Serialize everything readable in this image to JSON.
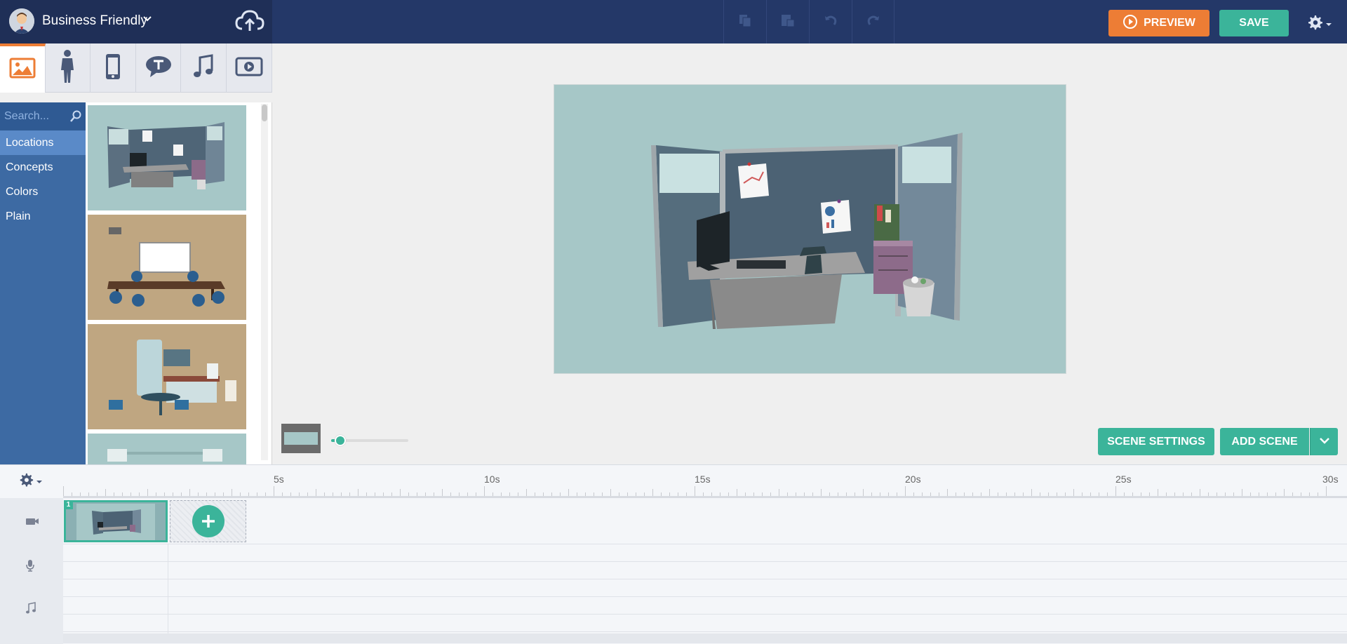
{
  "header": {
    "title": "Business Friendly",
    "preview_label": "PREVIEW",
    "save_label": "SAVE"
  },
  "search": {
    "placeholder": "Search..."
  },
  "categories": [
    {
      "label": "Locations",
      "active": true
    },
    {
      "label": "Concepts",
      "active": false
    },
    {
      "label": "Colors",
      "active": false
    },
    {
      "label": "Plain",
      "active": false
    }
  ],
  "asset_tabs": [
    "backgrounds-icon",
    "characters-icon",
    "device-icon",
    "text-bubble-icon",
    "music-icon",
    "video-icon"
  ],
  "toolbar_icons": [
    "copy-icon",
    "paste-icon",
    "undo-icon",
    "redo-icon"
  ],
  "scene": {
    "settings_label": "SCENE SETTINGS",
    "add_scene_label": "ADD SCENE",
    "zoom_level": 0.12
  },
  "timeline": {
    "ruler_labels": [
      "5s",
      "10s",
      "15s",
      "20s",
      "25s",
      "30s"
    ],
    "scene_clips": [
      {
        "number": "1"
      }
    ],
    "tracks": [
      "camera-icon",
      "microphone-icon",
      "music-note-icon"
    ]
  },
  "colors": {
    "header_bg": "#243868",
    "accent_orange": "#ed7d35",
    "accent_green": "#3bb49a",
    "sidebar_blue": "#3d6aa3"
  }
}
